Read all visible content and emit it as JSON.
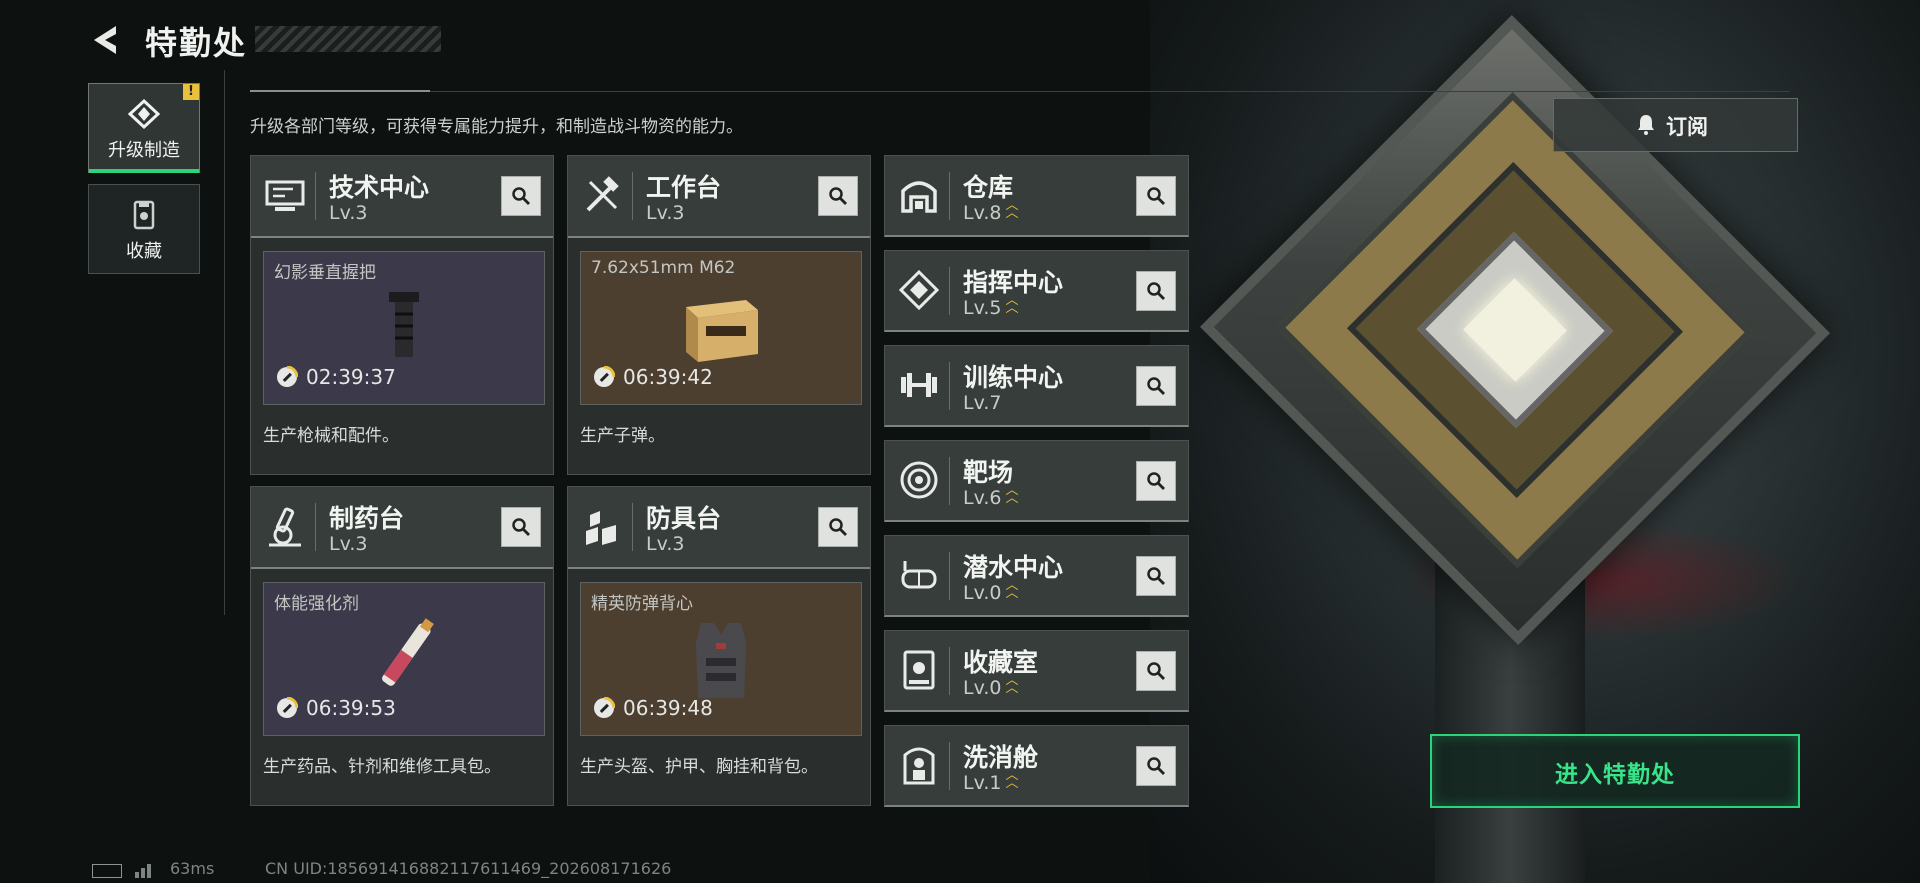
{
  "header": {
    "title": "特勤处"
  },
  "description": "升级各部门等级，可获得专属能力提升，和制造战斗物资的能力。",
  "sidebar": {
    "tabs": [
      {
        "label": "升级制造",
        "badge": "!",
        "active": true
      },
      {
        "label": "收藏",
        "active": false
      }
    ]
  },
  "subscribe": {
    "label": "订阅"
  },
  "enter_button": {
    "label": "进入特勤处"
  },
  "accent_color": "#2bd47a",
  "production_departments": [
    {
      "name": "技术中心",
      "level": "Lv.3",
      "item": "幻影垂直握把",
      "timer": "02:39:37",
      "description": "生产枪械和配件。",
      "icon": "tech-center-icon"
    },
    {
      "name": "工作台",
      "level": "Lv.3",
      "item": "7.62x51mm M62",
      "timer": "06:39:42",
      "description": "生产子弹。",
      "icon": "workbench-icon"
    },
    {
      "name": "制药台",
      "level": "Lv.3",
      "item": "体能强化剂",
      "timer": "06:39:53",
      "description": "生产药品、针剂和维修工具包。",
      "icon": "pharmacy-icon"
    },
    {
      "name": "防具台",
      "level": "Lv.3",
      "item": "精英防弹背心",
      "timer": "06:39:48",
      "description": "生产头盔、护甲、胸挂和背包。",
      "icon": "armor-bench-icon"
    }
  ],
  "other_departments": [
    {
      "name": "仓库",
      "level": "Lv.8",
      "upgrade": true,
      "icon": "warehouse-icon"
    },
    {
      "name": "指挥中心",
      "level": "Lv.5",
      "upgrade": true,
      "icon": "command-center-icon"
    },
    {
      "name": "训练中心",
      "level": "Lv.7",
      "upgrade": false,
      "icon": "training-center-icon"
    },
    {
      "name": "靶场",
      "level": "Lv.6",
      "upgrade": true,
      "icon": "shooting-range-icon"
    },
    {
      "name": "潜水中心",
      "level": "Lv.0",
      "upgrade": true,
      "icon": "diving-center-icon"
    },
    {
      "name": "收藏室",
      "level": "Lv.0",
      "upgrade": true,
      "icon": "collection-room-icon"
    },
    {
      "name": "洗消舱",
      "level": "Lv.1",
      "upgrade": true,
      "icon": "decontamination-icon"
    }
  ],
  "status": {
    "ping": "63ms",
    "uid": "CN UID:185691416882117611469_202608171626"
  }
}
